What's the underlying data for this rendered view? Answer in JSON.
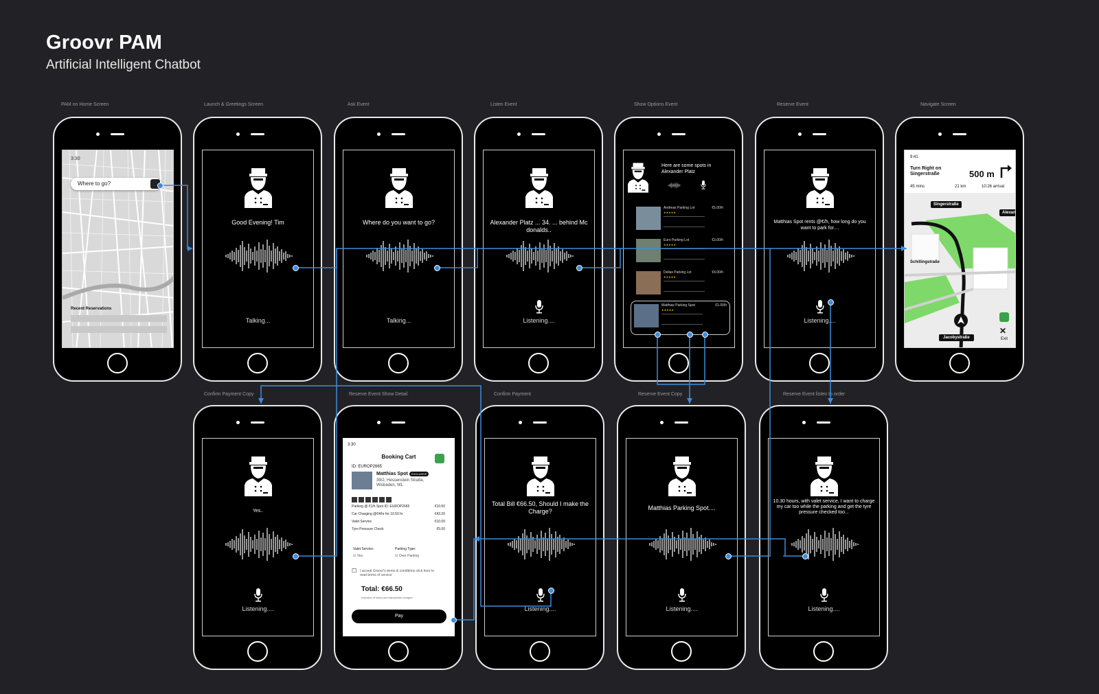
{
  "header": {
    "title": "Groovr PAM",
    "subtitle": "Artificial Intelligent Chatbot"
  },
  "screens": {
    "home": {
      "caption": "PAM on Home Screen",
      "time": "3:30",
      "search_placeholder": "Where to go?",
      "recent_title": "Recent Reservations"
    },
    "launch": {
      "caption": "Launch & Greetings Screen",
      "speech": "Good Evening! Tim",
      "status": "Talking..."
    },
    "ask": {
      "caption": "Ask Event",
      "speech": "Where do you want to go?",
      "status": "Talking..."
    },
    "listen": {
      "caption": "Listen Event",
      "speech": "Alexander Platz ... 34. ... behind Mc donalds..",
      "status": "Listening...."
    },
    "options": {
      "caption": "Show Options Event",
      "speech": "Here are some spots in Alexander Platz",
      "lots": [
        {
          "name": "Andreas Parking Lot",
          "price": "€5.00/h"
        },
        {
          "name": "Euro Parking Lot",
          "price": "€3.00/h"
        },
        {
          "name": "Dellas Parking Lot",
          "price": "€4.00/h"
        },
        {
          "name": "Matthias Parking Spot",
          "price": "€1.00/h"
        }
      ]
    },
    "reserve": {
      "caption": "Reserve Event",
      "speech": "Matthias Spot rents @€/h, how long do you want to park for....",
      "status": "Listening...."
    },
    "navigate": {
      "caption": "Navigate Screen",
      "time": "9:41",
      "instruction": "Turn Right on Singerstraße",
      "distance": "500 m",
      "eta_mins": "45 mins",
      "eta_km": "21 km",
      "arrival": "10:26 arrival",
      "street_1": "Singerstraße",
      "street_2": "Alexand",
      "street_3": "Schillingstraße",
      "street_current": "Jacobystraße",
      "exit_label": "Exit"
    },
    "confirm_copy": {
      "caption": "Confirm Payment Copy",
      "speech": "Yes..",
      "status": "Listening...."
    },
    "cart": {
      "caption": "Reserve Event Show Detail",
      "time": "3:30",
      "title": "Booking Cart",
      "booking_id": "ID: EUROP2665",
      "spot_name": "Matthias Spot",
      "spot_badge": "EXCLUSIVE",
      "address": "39/2, Hessenstein Straße, Wisbaden, WL",
      "lines": [
        {
          "label": "Parking @ €1/h Spot ID: EUROP2665",
          "amount": "€10.50"
        },
        {
          "label": "Car Charging @€4/hr for 10.50 hr",
          "amount": "€43.20"
        },
        {
          "label": "Valet Service",
          "amount": "€10.00"
        },
        {
          "label": "Tyre Pressure Check",
          "amount": "€5.00"
        }
      ],
      "valet_label": "Valet Service:",
      "valet_value": "Yes",
      "parking_type_label": "Parking Type:",
      "parking_type_value": "Over Parking",
      "terms": "I accept Groovr's terms & conditions click here to read terms of service",
      "total": "Total: €66.50",
      "total_note": "Inclusive of taxes and transaction charges",
      "pay_label": "Pay"
    },
    "confirm": {
      "caption": "Confirm Payment",
      "speech": "Total Bill €66.50, Should I make the Charge?",
      "status": "Listening...."
    },
    "reserve_copy": {
      "caption": "Reserve Event Copy",
      "speech": "Matthias Parking Spot....",
      "status": "Listening...."
    },
    "listen_order": {
      "caption": "Reserve Event listen to order",
      "speech": "10.30 hours, with valet service, I want to charge my car too while the parking and get the tyre pressure checked too...",
      "status": "Listening...."
    }
  },
  "colors": {
    "background": "#222226",
    "accent": "#3c8dde",
    "brand_green": "#3aa24a"
  },
  "icons": {
    "assistant": "bellboy-icon",
    "mic": "microphone-icon",
    "wave": "voice-wave-icon"
  }
}
